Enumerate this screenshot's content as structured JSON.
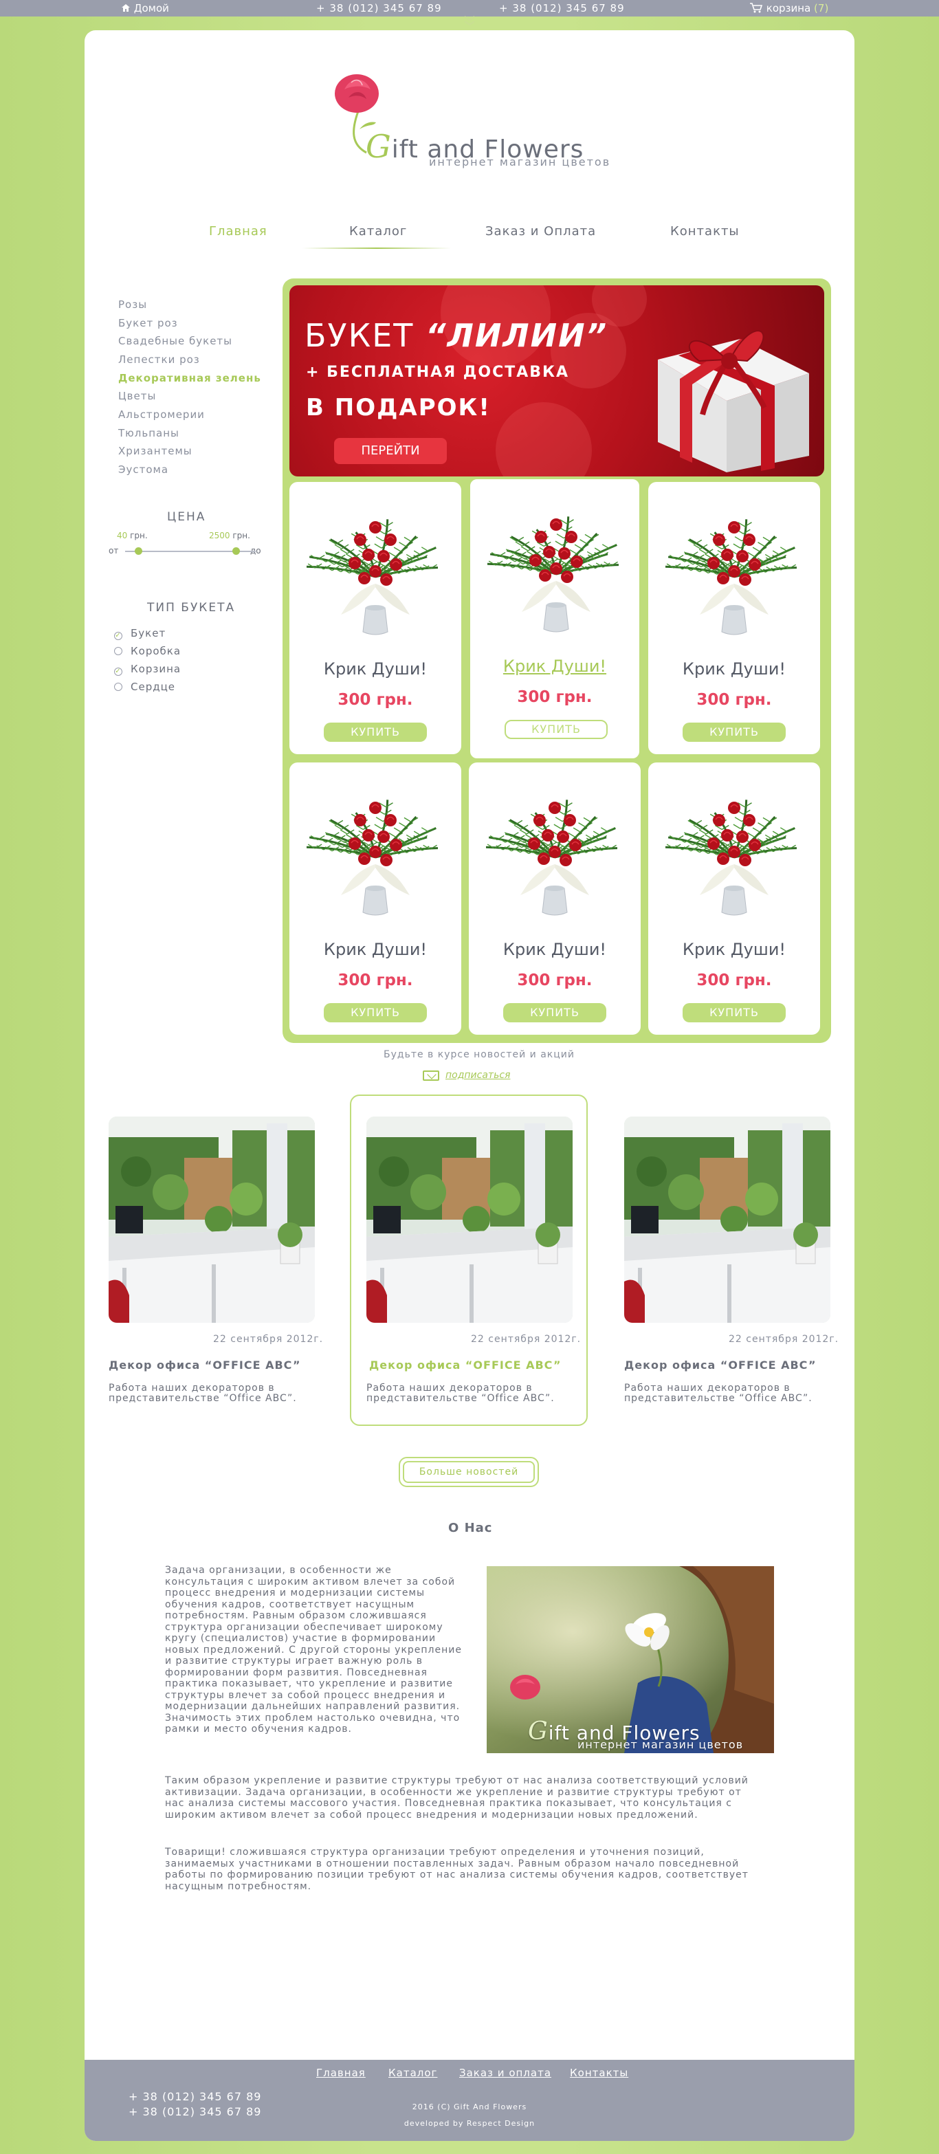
{
  "topbar": {
    "home_label": "Домой",
    "phone_1": "+ 38 (012) 345 67 89",
    "phone_2": "+ 38 (012) 345 67 89",
    "cart_label": "корзина",
    "cart_count": "(7)"
  },
  "logo": {
    "title_first_letter": "G",
    "title_rest": "ift and Flowers",
    "subtitle": "интернет магазин цветов"
  },
  "nav": [
    "Главная",
    "Каталог",
    "Заказ и Оплата",
    "Контакты"
  ],
  "sidebar": {
    "categories": [
      "Розы",
      "Букет роз",
      "Свадебные букеты",
      "Лепестки роз",
      "Декоративная зелень",
      "Цветы",
      "Альстромерии",
      "Тюльпаны",
      "Хризантемы",
      "Эустома"
    ],
    "active_category_index": 4,
    "price": {
      "title": "ЦЕНА",
      "min_value": "40",
      "max_value": "2500",
      "unit": "грн.",
      "from_label": "от",
      "to_label": "до"
    },
    "bouquet_type": {
      "title": "ТИП БУКЕТА",
      "options": [
        {
          "label": "Букет",
          "checked": true
        },
        {
          "label": "Коробка",
          "checked": false
        },
        {
          "label": "Корзина",
          "checked": true
        },
        {
          "label": "Сердце",
          "checked": false
        }
      ]
    }
  },
  "banner": {
    "line1_prefix": "БУКЕТ",
    "line1_highlight": "“ЛИЛИИ”",
    "line2": "+ БЕСПЛАТНАЯ ДОСТАВКА",
    "line3": "В ПОДАРОК!",
    "button_label": "ПЕРЕЙТИ"
  },
  "products": [
    {
      "name": "Крик Души!",
      "price": "300 грн.",
      "buy_label": "КУПИТЬ",
      "highlighted": false
    },
    {
      "name": "Крик Души!",
      "price": "300 грн.",
      "buy_label": "КУПИТЬ",
      "highlighted": true
    },
    {
      "name": "Крик Души!",
      "price": "300 грн.",
      "buy_label": "КУПИТЬ",
      "highlighted": false
    },
    {
      "name": "Крик Души!",
      "price": "300 грн.",
      "buy_label": "КУПИТЬ",
      "highlighted": false
    },
    {
      "name": "Крик Души!",
      "price": "300 грн.",
      "buy_label": "КУПИТЬ",
      "highlighted": false
    },
    {
      "name": "Крик Души!",
      "price": "300 грн.",
      "buy_label": "КУПИТЬ",
      "highlighted": false
    }
  ],
  "subscribe": {
    "text": "Будьте в курсе новостей и акций",
    "link": "подписаться"
  },
  "news": [
    {
      "date": "22 сентября 2012г.",
      "title": "Декор офиса “OFFICE ABC”",
      "text": " Работа наших декораторов в представительстве “Office ABC”."
    },
    {
      "date": "22 сентября 2012г.",
      "title": "Декор офиса “OFFICE ABC”",
      "text": " Работа наших декораторов в представительстве “Office ABC”."
    },
    {
      "date": "22 сентября 2012г.",
      "title": "Декор офиса “OFFICE ABC”",
      "text": " Работа наших декораторов в представительстве “Office ABC”."
    }
  ],
  "more_news_label": "Больше новостей",
  "about": {
    "title": "О Нас",
    "p1": " Задача организации, в особенности же консультация с широким активом влечет за собой процесс внедрения и модернизации системы обучения кадров, соответствует насущным потребностям. Равным образом сложившаяся структура организации обеспечивает широкому кругу (специалистов) участие в формировании новых предложений. С другой стороны укрепление и развитие структуры играет важную роль в формировании форм развития. Повседневная практика показывает, что укрепление и развитие структуры влечет за собой процесс внедрения и модернизации дальнейших направлений развития. Значимость этих проблем настолько очевидна, что рамки и место обучения кадров.",
    "p2": " Таким образом укрепление и развитие структуры требуют от нас анализа соответствующий условий активизации. Задача организации, в особенности же укрепление и развитие структуры требуют от нас анализа системы массового участия. Повседневная практика показывает, что консультация с широким активом влечет за собой процесс внедрения и модернизации новых предложений.",
    "p3": " Товарищи! сложившаяся структура организации требуют определения и уточнения позиций, занимаемых участниками в отношении поставленных задач. Равным образом начало повседневной работы по формированию позиции требуют от нас анализа системы обучения кадров, соответствует насущным потребностям.",
    "image_title_first": "G",
    "image_title_rest": "ift and Flowers",
    "image_subtitle": "интернет магазин цветов"
  },
  "footer": {
    "links": [
      "Главная",
      "Каталог",
      "Заказ и оплата",
      "Контакты"
    ],
    "phone_1": "+ 38 (012) 345 67 89",
    "phone_2": "+ 38 (012) 345 67 89",
    "copyright": "2016 (C) Gift And Flowers",
    "developer": "developed by Respect Design"
  },
  "colors": {
    "accent_green": "#a7c957",
    "frame_green": "#bfdd7b",
    "price_red": "#e74661",
    "bar_gray": "#9a9eac"
  }
}
